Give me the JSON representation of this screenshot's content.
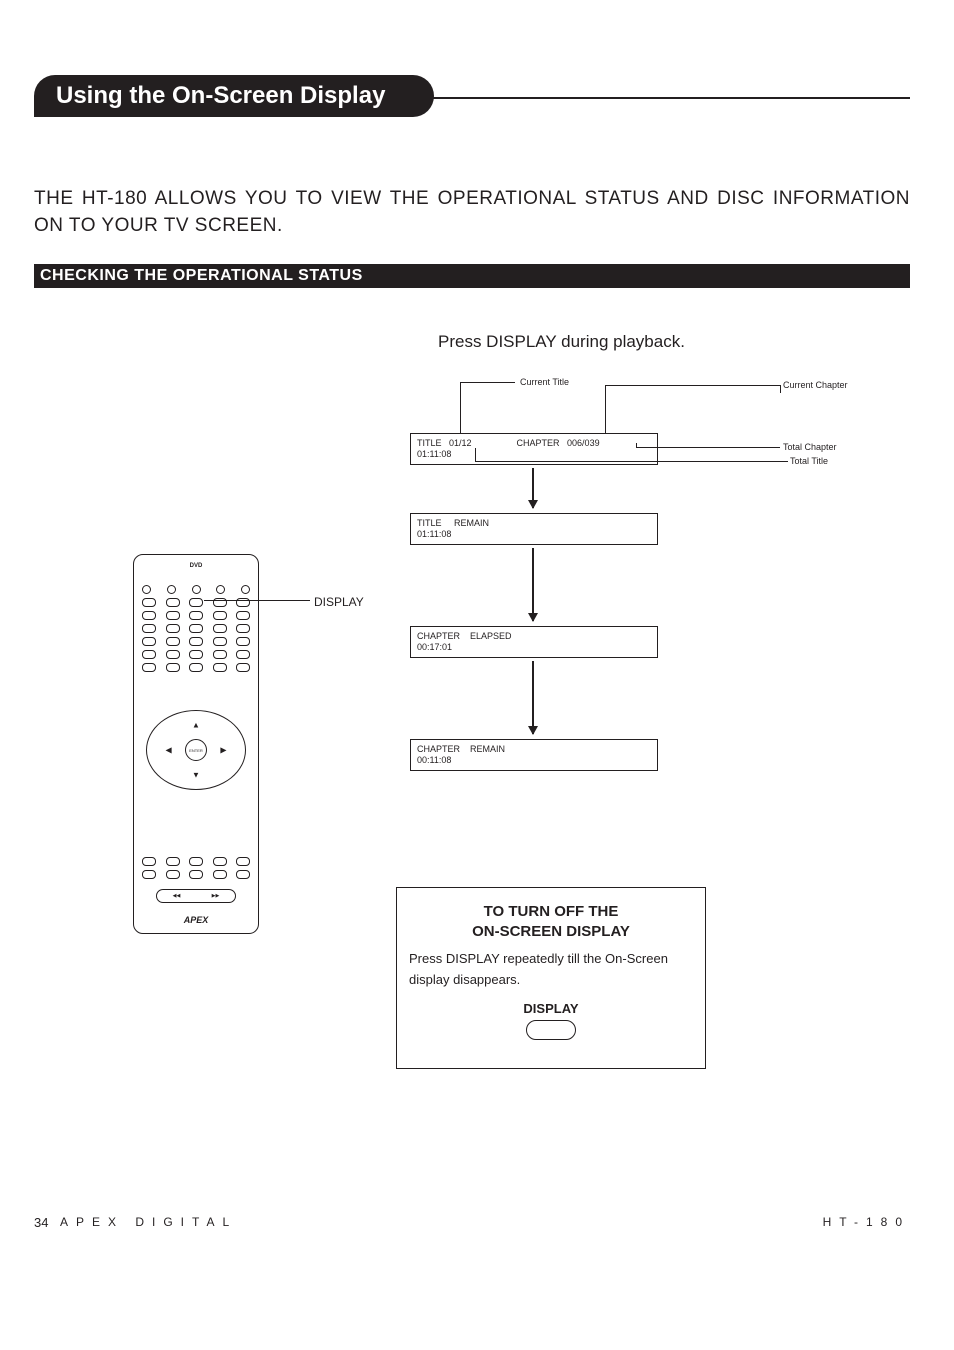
{
  "header": {
    "title": "Using the On-Screen Display"
  },
  "intro": "THE HT-180 ALLOWS YOU TO VIEW THE OPERATIONAL STATUS AND DISC INFORMATION ON TO YOUR TV SCREEN.",
  "section": {
    "title": "CHECKING THE OPERATIONAL STATUS"
  },
  "press_line": "Press DISPLAY during playback.",
  "callout": "DISPLAY",
  "labels": {
    "current_title": "Current Title",
    "current_chapter": "Current Chapter",
    "total_chapter": "Total Chapter",
    "total_title": "Total Title"
  },
  "osd": [
    {
      "line1": "TITLE   01/12                  CHAPTER   006/039",
      "line2": "01:11:08"
    },
    {
      "line1": "TITLE     REMAIN",
      "line2": "01:11:08"
    },
    {
      "line1": "CHAPTER    ELAPSED",
      "line2": "00:17:01"
    },
    {
      "line1": "CHAPTER    REMAIN",
      "line2": "00:11:08"
    }
  ],
  "turnoff": {
    "heading1": "TO TURN OFF THE",
    "heading2": "ON-SCREEN DISPLAY",
    "body": "Press DISPLAY repeatedly till the On-Screen display disappears.",
    "button_label": "DISPLAY"
  },
  "remote": {
    "top": "DVD",
    "enter": "ENTER",
    "logo": "APEX"
  },
  "footer": {
    "page": "34",
    "brand": "APEX DIGITAL",
    "model": "HT-180"
  }
}
